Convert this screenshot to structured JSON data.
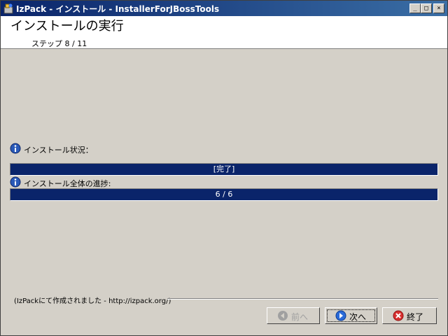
{
  "window": {
    "title": "IzPack - インストール - InstallerForJBossTools",
    "controls": {
      "minimize": "_",
      "maximize": "□",
      "close": "×"
    }
  },
  "header": {
    "heading": "インストールの実行",
    "step": "ステップ 8 / 11"
  },
  "status": {
    "label": "インストール状況：",
    "bar_text": "[完了]",
    "progress": 1.0
  },
  "overall": {
    "label": "インストール全体の進捗:",
    "bar_text": "6 / 6",
    "progress": 1.0
  },
  "footer": {
    "credit": "(IzPackにて作成されました - http://izpack.org/)"
  },
  "buttons": {
    "previous": "前へ",
    "next": "次へ",
    "quit": "終了"
  },
  "colors": {
    "progress_fill": "#0a246a",
    "title_bar": "#0a246a",
    "background": "#d4d0c8"
  },
  "icons": [
    "java-app-icon",
    "info-icon",
    "back-arrow-icon",
    "next-arrow-icon",
    "quit-x-icon"
  ]
}
